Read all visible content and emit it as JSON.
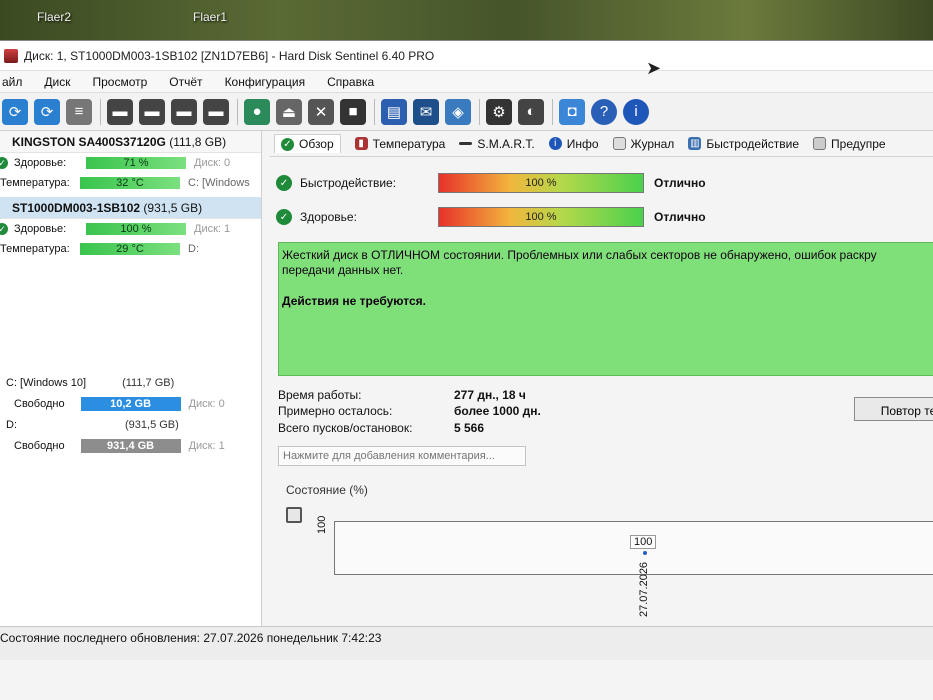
{
  "desktop": {
    "icons": [
      "Flaer2",
      "Flaer1"
    ]
  },
  "window": {
    "title": "Диск: 1, ST1000DM003-1SB102 [ZN1D7EB6]  -  Hard Disk Sentinel 6.40 PRO"
  },
  "menu": [
    "айл",
    "Диск",
    "Просмотр",
    "Отчёт",
    "Конфигурация",
    "Справка"
  ],
  "toolbar_icons": [
    "refresh-icon",
    "refresh-all-icon",
    "list-icon",
    "disk-tool-1-icon",
    "disk-tool-2-icon",
    "disk-tool-3-icon",
    "disk-tool-4-icon",
    "globe-icon",
    "eject-icon",
    "tools-icon",
    "puzzle-icon",
    "notepad-icon",
    "mail-icon",
    "network-icon",
    "gear-icon",
    "alert-icon",
    "screenshot-icon",
    "help-icon",
    "info-icon"
  ],
  "disks": [
    {
      "name": "KINGSTON SA400S37120G",
      "capacity": "(111,8 GB)",
      "health_label": "Здоровье:",
      "health": "71 %",
      "health_disk": "Диск: 0",
      "temp_label": "Температура:",
      "temp": "32 °C",
      "temp_extra": "C: [Windows"
    },
    {
      "name": "ST1000DM003-1SB102",
      "capacity": "(931,5 GB)",
      "health_label": "Здоровье:",
      "health": "100 %",
      "health_disk": "Диск: 1",
      "temp_label": "Температура:",
      "temp": "29 °C",
      "temp_extra": "D:"
    }
  ],
  "drives": [
    {
      "name": "C: [Windows 10]",
      "size": "(111,7 GB)",
      "free_label": "Свободно",
      "free": "10,2 GB",
      "disk": "Диск: 0"
    },
    {
      "name": "D:",
      "size": "(931,5 GB)",
      "free_label": "Свободно",
      "free": "931,4 GB",
      "disk": "Диск: 1"
    }
  ],
  "tabs": [
    "Обзор",
    "Температура",
    "S.M.A.R.T.",
    "Инфо",
    "Журнал",
    "Быстродействие",
    "Предупре"
  ],
  "performance": {
    "label": "Быстродействие:",
    "value": "100 %",
    "rating": "Отлично"
  },
  "health": {
    "label": "Здоровье:",
    "value": "100 %",
    "rating": "Отлично"
  },
  "message": {
    "line1": "Жесткий диск в ОТЛИЧНОМ состоянии. Проблемных или слабых секторов не обнаружено, ошибок раскру",
    "line2": "передачи данных нет.",
    "action": "Действия не требуются."
  },
  "stats": [
    {
      "label": "Время работы:",
      "value": "277 дн., 18 ч"
    },
    {
      "label": "Примерно осталось:",
      "value": "более 1000 дн."
    },
    {
      "label": "Всего пусков/остановок:",
      "value": "5 566"
    }
  ],
  "report_button": "Повтор те",
  "comment_placeholder": "Нажмите для добавления комментария...",
  "chart_data": {
    "type": "line",
    "title": "Состояние (%)",
    "x": [
      "27.07.2026"
    ],
    "series": [
      {
        "values": [
          100
        ]
      }
    ],
    "y_tick": "100",
    "point_label": "100"
  },
  "statusbar": "Состояние последнего обновления: 27.07.2026 понедельник 7:42:23"
}
